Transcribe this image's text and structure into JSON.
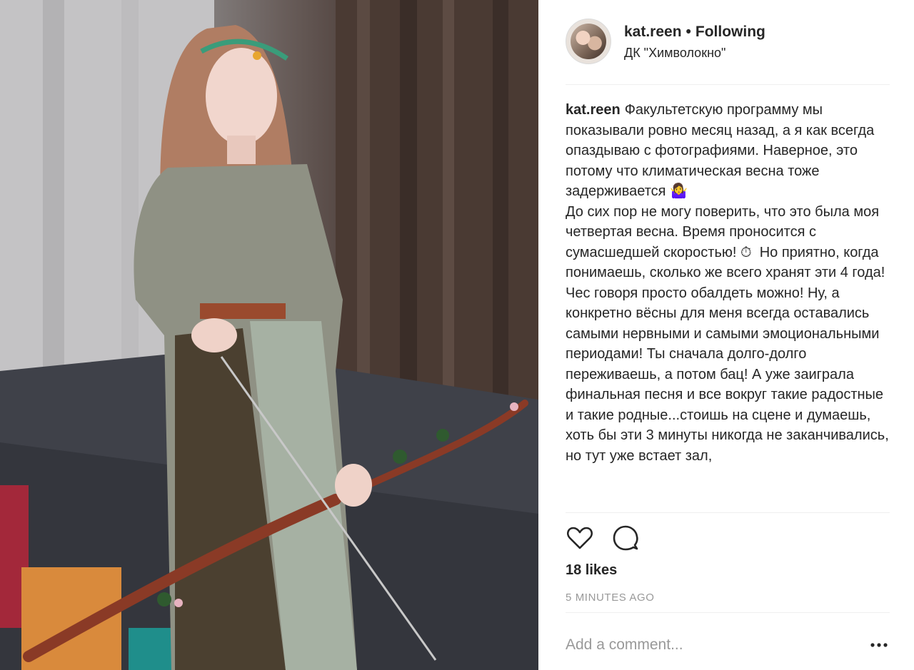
{
  "post": {
    "username": "kat.reen",
    "follow_status": "Following",
    "location": "ДК \"Химволокно\"",
    "caption_user": "kat.reen",
    "caption_text": "Факультетскую программу мы показывали ровно месяц назад, а я как всегда опаздываю с фотографиями. Наверное, это потому что климатическая весна тоже задерживается 🤷‍♀️\nДо сих пор не могу поверить, что это была моя четвертая весна. Время проносится с сумасшедшей скоростью! ⏱  Но приятно, когда понимаешь, сколько же всего хранят эти 4 года! Чес говоря просто обалдеть можно! Ну, а конкретно вёсны для меня всегда оставались самыми нервными и самыми эмоциональными периодами! Ты сначала долго-долго переживаешь, а потом бац! А уже заиграла финальная песня и все вокруг такие радостные и такие родные...стоишь на сцене и думаешь, хоть бы эти 3 минуты никогда не заканчивались, но тут уже встает зал,",
    "likes": "18 likes",
    "timestamp": "5 MINUTES AGO",
    "comment_placeholder": "Add a comment...",
    "icons": [
      "heart-icon",
      "comment-icon",
      "more-options-icon"
    ]
  }
}
